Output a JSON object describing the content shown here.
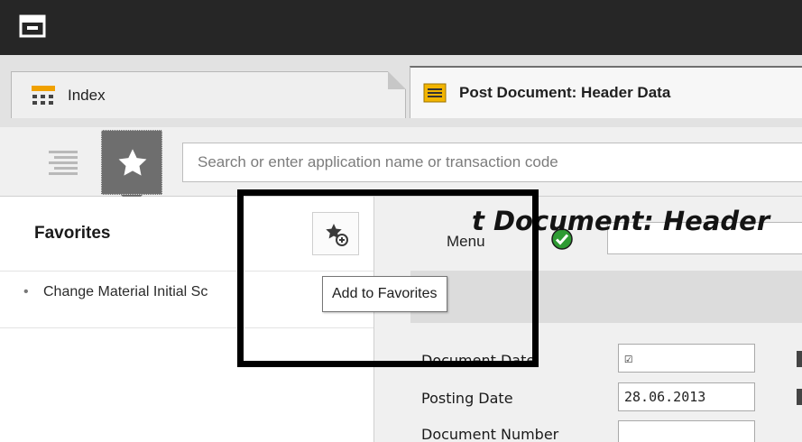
{
  "tabs": [
    {
      "label": "Index"
    },
    {
      "label": "Post Document: Header Data"
    }
  ],
  "search": {
    "placeholder": "Search or enter application name or transaction code",
    "value": ""
  },
  "favorites": {
    "title": "Favorites",
    "items": [
      {
        "label": "Change Material Initial Sc"
      }
    ]
  },
  "tooltip": {
    "text": "Add to Favorites"
  },
  "content": {
    "menu_label": "Menu",
    "doc_title": "t Document: Header",
    "fields": [
      {
        "label": "Document Date",
        "value": "☑"
      },
      {
        "label": "Posting Date",
        "value": "28.06.2013"
      },
      {
        "label": "Document Number",
        "value": ""
      }
    ]
  },
  "colors": {
    "titlebar": "#262626",
    "accent_orange": "#f0a100",
    "check_green": "#2e9b33"
  },
  "icons": [
    "app-icon",
    "hierarchy-icon",
    "list-icon",
    "star-icon",
    "star-add-icon",
    "check-icon"
  ]
}
